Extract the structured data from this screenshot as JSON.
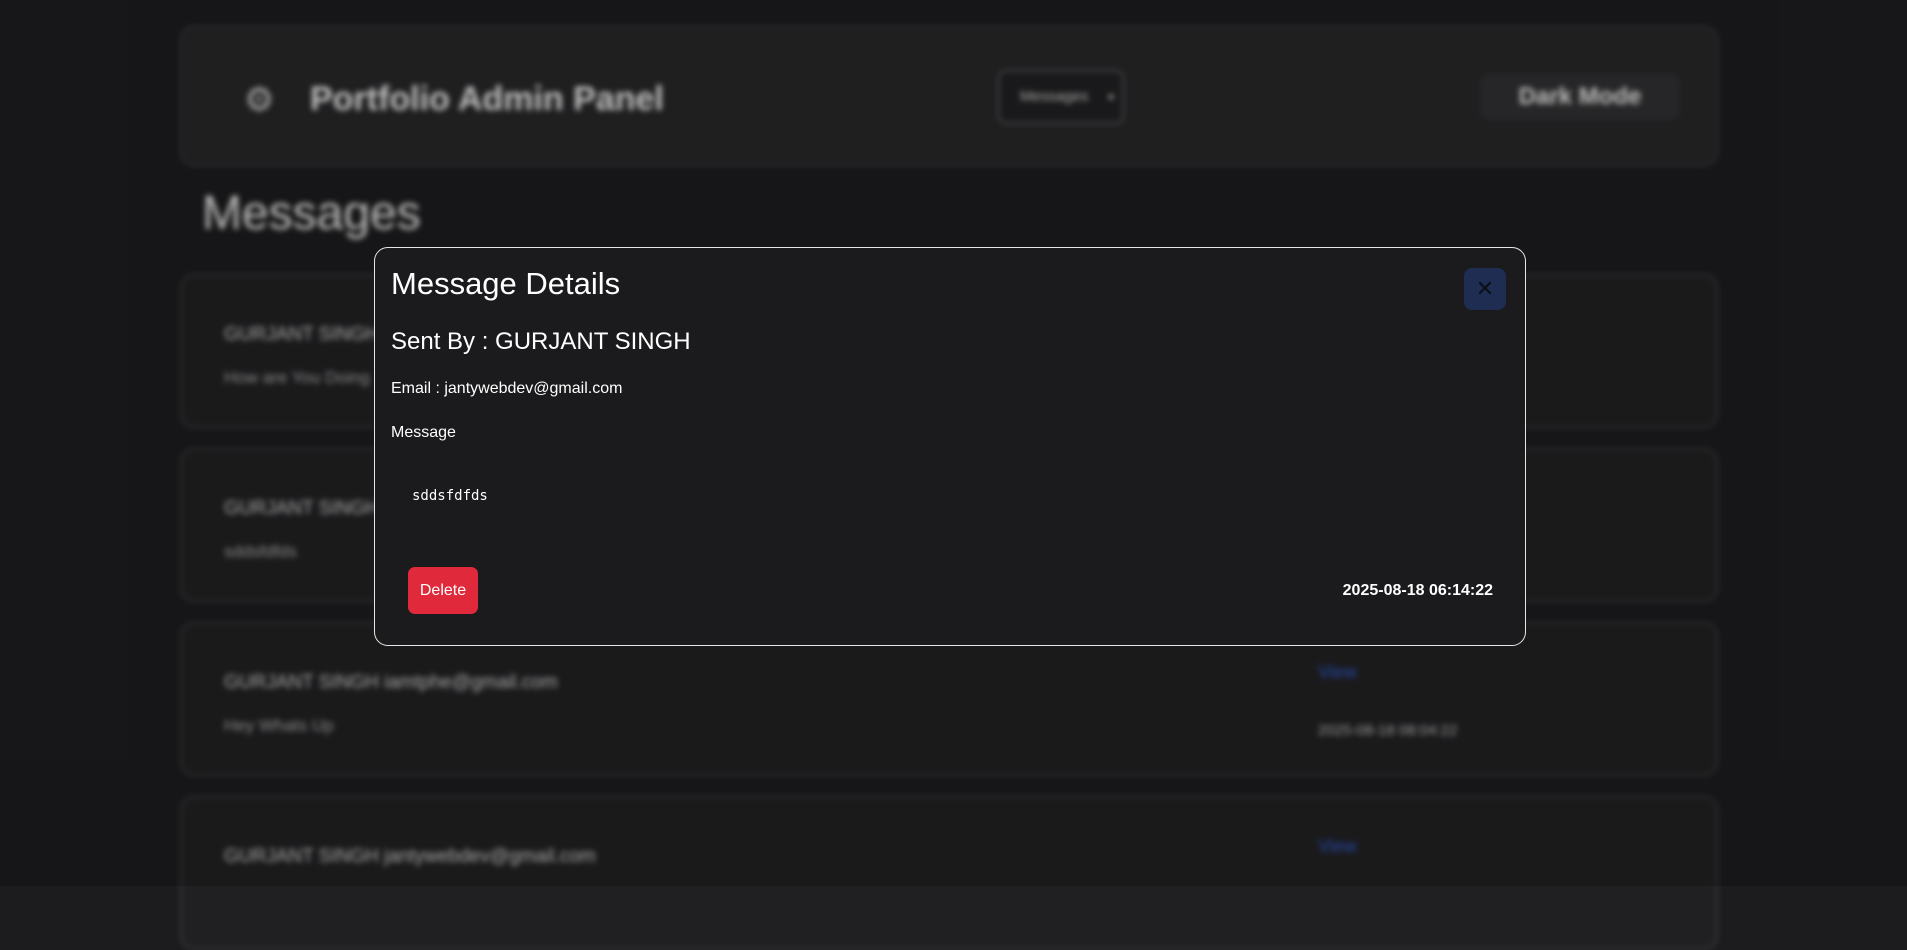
{
  "header": {
    "brand_icon": "gears-icon",
    "title": "Portfolio Admin Panel",
    "page_select": "Messages",
    "theme_toggle": "Dark Mode"
  },
  "page": {
    "heading": "Messages"
  },
  "messages": [
    {
      "sender": "GURJANT SINGH",
      "body": "How are You Doing",
      "view": "",
      "time": ""
    },
    {
      "sender": "GURJANT SINGH",
      "body": "sddsfdfds",
      "view": "",
      "time": ""
    },
    {
      "sender": "GURJANT SINGH  iamtphe@gmail.com",
      "body": "Hey Whats Up",
      "view": "View",
      "time": "2025-08-18 08:04:22"
    },
    {
      "sender": "GURJANT SINGH  jantywebdev@gmail.com",
      "body": "",
      "view": "View",
      "time": ""
    }
  ],
  "modal": {
    "title": "Message Details",
    "sent_by": "Sent By : GURJANT SINGH",
    "email": "Email : jantywebdev@gmail.com",
    "message_label": "Message",
    "message_content": "sddsfdfds",
    "delete_label": "Delete",
    "timestamp": "2025-08-18 06:14:22",
    "close_symbol": "✕"
  },
  "colors": {
    "background": "#1c1c1e",
    "danger": "#e02a3b",
    "link": "#2f58c9",
    "close_button": "#1f2d52"
  }
}
